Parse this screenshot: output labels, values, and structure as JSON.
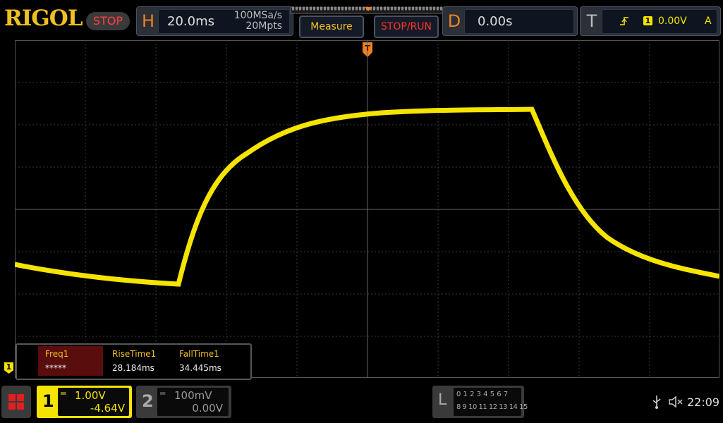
{
  "logo": "RIGOL",
  "status": "STOP",
  "horizontal": {
    "letter": "H",
    "timebase": "20.0ms",
    "sample_rate": "100MSa/s",
    "memory_depth": "20Mpts"
  },
  "buttons": {
    "measure": "Measure",
    "stop_run": "STOP/RUN"
  },
  "delay": {
    "letter": "D",
    "value": "0.00s"
  },
  "trigger": {
    "letter": "T",
    "source": "1",
    "level": "0.00V",
    "mode": "A",
    "marker": "T"
  },
  "measurements": [
    {
      "label": "Freq1",
      "value": "*****"
    },
    {
      "label": "RiseTime1",
      "value": "28.184ms"
    },
    {
      "label": "FallTime1",
      "value": "34.445ms"
    }
  ],
  "channel1": {
    "number": "1",
    "scale": "1.00V",
    "offset": "-4.64V",
    "marker": "1"
  },
  "channel2": {
    "number": "2",
    "scale": "100mV",
    "offset": "0.00V"
  },
  "logic": {
    "letter": "L",
    "row1": "0 1 2 3  4 5 6 7",
    "row2": "8 9 10 11 12 13 14 15"
  },
  "time": "22:09",
  "colors": {
    "accent": "#f0c020",
    "ch1": "#f5e400",
    "stop": "#ff3030",
    "orange": "#f08020"
  }
}
